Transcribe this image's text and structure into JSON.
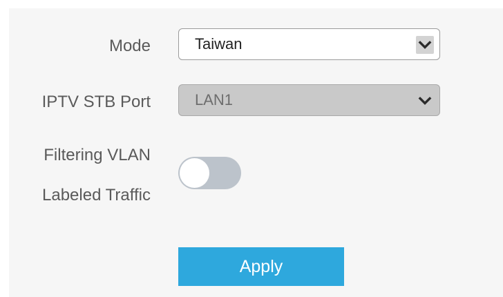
{
  "form": {
    "mode": {
      "label": "Mode",
      "value": "Taiwan",
      "icon": "chevron-down-icon"
    },
    "iptv_stb_port": {
      "label": "IPTV STB Port",
      "value": "LAN1",
      "disabled": true,
      "icon": "chevron-down-icon"
    },
    "filtering_vlan": {
      "label_line1": "Filtering VLAN",
      "label_line2": "Labeled Traffic",
      "enabled": false
    },
    "apply_label": "Apply"
  },
  "colors": {
    "accent": "#2ea8dd",
    "toggle_off": "#bcc3cb",
    "panel_bg": "#f6f6f6",
    "label_text": "#5a5a5a"
  }
}
